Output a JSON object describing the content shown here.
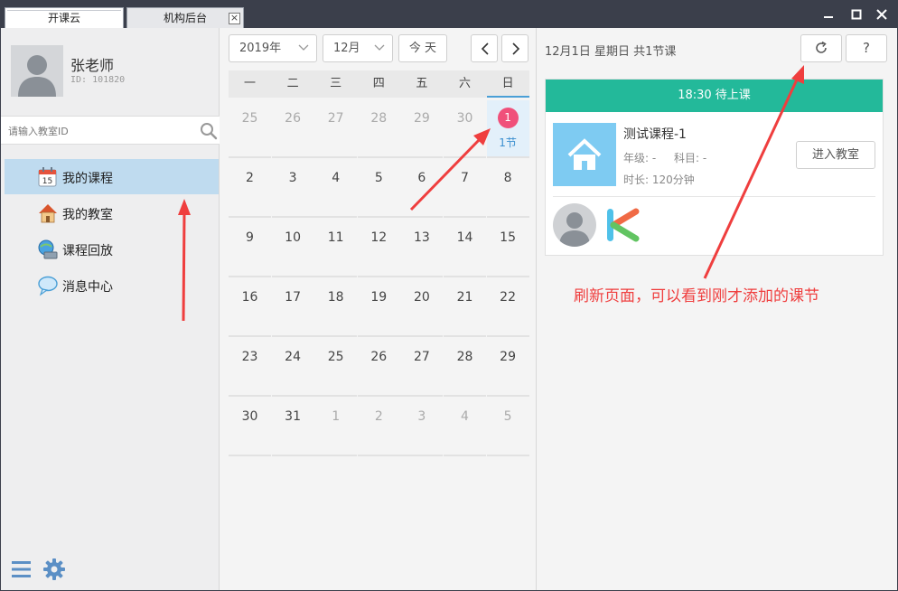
{
  "window": {
    "tabs": [
      {
        "label": "开课云",
        "active": true
      },
      {
        "label": "机构后台",
        "active": false
      }
    ],
    "tab_close_glyph": "×",
    "controls": {
      "minimize": "—",
      "maximize": "☐",
      "close": "✕"
    }
  },
  "user": {
    "name": "张老师",
    "id_text": "ID: 101820"
  },
  "search": {
    "placeholder": "请输入教室ID",
    "icon": "search-icon"
  },
  "sidebar": {
    "items": [
      {
        "label": "我的课程",
        "icon": "calendar-icon",
        "active": true
      },
      {
        "label": "我的教室",
        "icon": "house-icon",
        "active": false
      },
      {
        "label": "课程回放",
        "icon": "playback-icon",
        "active": false
      },
      {
        "label": "消息中心",
        "icon": "chat-bubble-icon",
        "active": false
      }
    ],
    "bottom_icons": [
      "menu-icon",
      "gear-icon"
    ]
  },
  "calendar": {
    "year_label": "2019年",
    "month_label": "12月",
    "today_label": "今 天",
    "prev": "previous-month",
    "next": "next-month",
    "weekdays": [
      "一",
      "二",
      "三",
      "四",
      "五",
      "六",
      "日"
    ],
    "weeks": [
      [
        {
          "d": "25",
          "other": true
        },
        {
          "d": "26",
          "other": true
        },
        {
          "d": "27",
          "other": true
        },
        {
          "d": "28",
          "other": true
        },
        {
          "d": "29",
          "other": true
        },
        {
          "d": "30",
          "other": true
        },
        {
          "d": "1",
          "other": false,
          "badge": true,
          "lessons": "1节"
        }
      ],
      [
        {
          "d": "2"
        },
        {
          "d": "3"
        },
        {
          "d": "4"
        },
        {
          "d": "5"
        },
        {
          "d": "6"
        },
        {
          "d": "7"
        },
        {
          "d": "8"
        }
      ],
      [
        {
          "d": "9"
        },
        {
          "d": "10"
        },
        {
          "d": "11"
        },
        {
          "d": "12"
        },
        {
          "d": "13"
        },
        {
          "d": "14"
        },
        {
          "d": "15"
        }
      ],
      [
        {
          "d": "16"
        },
        {
          "d": "17"
        },
        {
          "d": "18"
        },
        {
          "d": "19"
        },
        {
          "d": "20"
        },
        {
          "d": "21"
        },
        {
          "d": "22"
        }
      ],
      [
        {
          "d": "23"
        },
        {
          "d": "24"
        },
        {
          "d": "25"
        },
        {
          "d": "26"
        },
        {
          "d": "27"
        },
        {
          "d": "28"
        },
        {
          "d": "29"
        }
      ],
      [
        {
          "d": "30"
        },
        {
          "d": "31"
        },
        {
          "d": "1",
          "other": true
        },
        {
          "d": "2",
          "other": true
        },
        {
          "d": "3",
          "other": true
        },
        {
          "d": "4",
          "other": true
        },
        {
          "d": "5",
          "other": true
        }
      ]
    ]
  },
  "detail": {
    "summary": "12月1日 星期日 共1节课",
    "refresh_glyph": "↻",
    "help_glyph": "?",
    "course": {
      "header": "18:30 待上课",
      "title": "测试课程-1",
      "grade": "年级: -",
      "subject": "科目: -",
      "duration": "时长: 120分钟",
      "enter_label": "进入教室"
    },
    "annotation": "刷新页面，可以看到刚才添加的课节"
  },
  "colors": {
    "titlebar": "#3b3f4b",
    "active_nav": "#bfdbef",
    "course_header": "#23b99a",
    "badge": "#f0507a",
    "annotation": "#ef3e3e",
    "link_blue": "#3b8fd0"
  }
}
